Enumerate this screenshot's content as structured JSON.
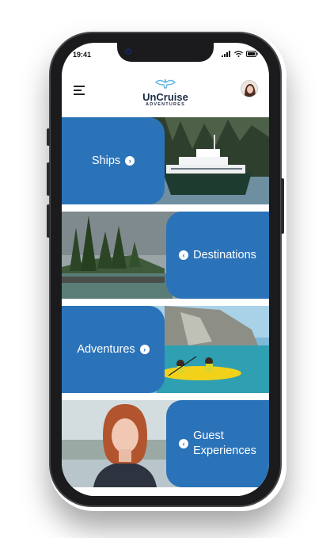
{
  "status_bar": {
    "time": "19:41"
  },
  "header": {
    "logo_title": "UnCruise",
    "logo_subtitle": "ADVENTURES"
  },
  "cards": [
    {
      "label": "Ships",
      "arrow": "›"
    },
    {
      "label": "Destinations",
      "arrow": "‹"
    },
    {
      "label": "Adventures",
      "arrow": "›"
    },
    {
      "label_line1": "Guest",
      "label_line2": "Experiences",
      "arrow": "‹"
    }
  ],
  "colors": {
    "accent": "#2b73b9",
    "logo_text": "#1c2a44"
  },
  "icons": [
    "menu-icon",
    "wifi-icon",
    "signal-icon",
    "battery-icon",
    "chevron-right-icon",
    "chevron-left-icon"
  ]
}
